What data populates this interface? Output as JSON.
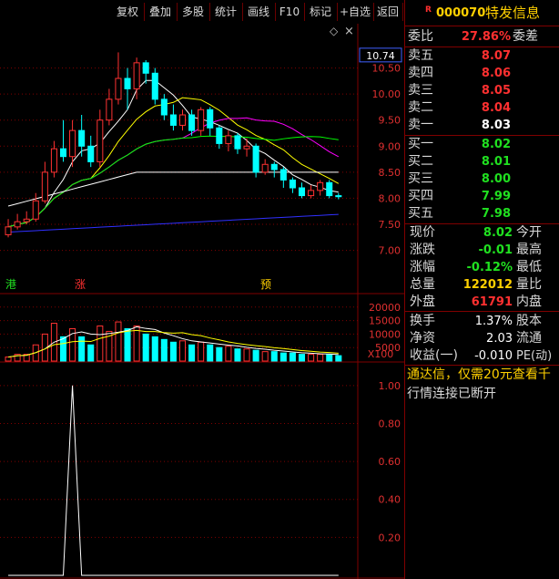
{
  "toolbar": {
    "buttons": [
      "复权",
      "叠加",
      "多股",
      "统计",
      "画线",
      "F10",
      "标记",
      "+自选",
      "返回"
    ]
  },
  "stock": {
    "r_mark": "R",
    "code": "000070",
    "name": "特发信息"
  },
  "orderbook": {
    "webi_label": "委比",
    "webi_value": "27.86%",
    "wecha_label": "委差",
    "asks": [
      {
        "label": "卖五",
        "price": "8.07"
      },
      {
        "label": "卖四",
        "price": "8.06"
      },
      {
        "label": "卖三",
        "price": "8.05"
      },
      {
        "label": "卖二",
        "price": "8.04"
      },
      {
        "label": "卖一",
        "price": "8.03"
      }
    ],
    "bids": [
      {
        "label": "买一",
        "price": "8.02"
      },
      {
        "label": "买二",
        "price": "8.01"
      },
      {
        "label": "买三",
        "price": "8.00"
      },
      {
        "label": "买四",
        "price": "7.99"
      },
      {
        "label": "买五",
        "price": "7.98"
      }
    ]
  },
  "quote": {
    "current_label": "现价",
    "current_value": "8.02",
    "open_label": "今开",
    "change_label": "涨跌",
    "change_value": "-0.01",
    "high_label": "最高",
    "pct_label": "涨幅",
    "pct_value": "-0.12%",
    "low_label": "最低",
    "volume_label": "总量",
    "volume_value": "122012",
    "ratio_label": "量比",
    "outer_label": "外盘",
    "outer_value": "61791",
    "inner_label": "内盘",
    "turnover_label": "换手",
    "turnover_value": "1.37%",
    "equity_label": "股本",
    "netasset_label": "净资",
    "netasset_value": "2.03",
    "float_label": "流通",
    "eps_label": "收益(一)",
    "eps_value": "-0.010",
    "pe_label": "PE(动)"
  },
  "notice": {
    "ad_text": "通达信，仅需20元查看千",
    "status_text": "行情连接已断开"
  },
  "price_axis": {
    "labels": [
      "10.50",
      "10.00",
      "9.50",
      "9.00",
      "8.50",
      "8.00",
      "7.50",
      "7.00"
    ],
    "current_price_box": "10.74"
  },
  "volume_axis": {
    "labels": [
      "20000",
      "15000",
      "10000",
      "5000"
    ],
    "unit": "X100"
  },
  "indicator_axis": {
    "labels": [
      "1.00",
      "0.80",
      "0.60",
      "0.40",
      "0.20"
    ]
  },
  "event_markers": [
    "港",
    "涨",
    "预"
  ],
  "colors": {
    "up": "#ff3232",
    "down": "#00ffff",
    "grid": "#800000",
    "ma5": "#ffffff",
    "ma10": "#ffff00",
    "ma20": "#ff00ff",
    "ma60": "#00ff00",
    "ma120": "#ffffff",
    "ma250": "#3030ff"
  },
  "chart_data": [
    {
      "type": "candlestick",
      "ylim": [
        6.8,
        11.0
      ],
      "ticks": [
        10.5,
        10.0,
        9.5,
        9.0,
        8.5,
        8.0,
        7.5,
        7.0
      ],
      "candles": [
        {
          "o": 7.3,
          "c": 7.45,
          "h": 7.6,
          "l": 7.25
        },
        {
          "o": 7.45,
          "c": 7.55,
          "h": 7.7,
          "l": 7.4
        },
        {
          "o": 7.55,
          "c": 7.6,
          "h": 7.75,
          "l": 7.5
        },
        {
          "o": 7.6,
          "c": 7.95,
          "h": 8.1,
          "l": 7.55
        },
        {
          "o": 7.95,
          "c": 8.5,
          "h": 8.7,
          "l": 7.9
        },
        {
          "o": 8.5,
          "c": 8.95,
          "h": 9.1,
          "l": 8.4
        },
        {
          "o": 8.95,
          "c": 8.8,
          "h": 9.5,
          "l": 8.7
        },
        {
          "o": 8.8,
          "c": 9.3,
          "h": 9.5,
          "l": 8.6
        },
        {
          "o": 9.3,
          "c": 9.0,
          "h": 9.6,
          "l": 8.8
        },
        {
          "o": 9.0,
          "c": 8.7,
          "h": 9.2,
          "l": 8.6
        },
        {
          "o": 8.7,
          "c": 9.5,
          "h": 9.7,
          "l": 8.6
        },
        {
          "o": 9.5,
          "c": 9.9,
          "h": 10.1,
          "l": 9.4
        },
        {
          "o": 9.9,
          "c": 10.3,
          "h": 10.8,
          "l": 9.8
        },
        {
          "o": 10.3,
          "c": 10.1,
          "h": 10.5,
          "l": 9.7
        },
        {
          "o": 10.1,
          "c": 10.6,
          "h": 10.7,
          "l": 9.9
        },
        {
          "o": 10.6,
          "c": 10.4,
          "h": 10.65,
          "l": 10.2
        },
        {
          "o": 10.4,
          "c": 9.9,
          "h": 10.5,
          "l": 9.8
        },
        {
          "o": 9.9,
          "c": 9.6,
          "h": 10.0,
          "l": 9.5
        },
        {
          "o": 9.6,
          "c": 9.4,
          "h": 9.8,
          "l": 9.3
        },
        {
          "o": 9.4,
          "c": 9.6,
          "h": 9.7,
          "l": 9.3
        },
        {
          "o": 9.6,
          "c": 9.3,
          "h": 9.7,
          "l": 9.2
        },
        {
          "o": 9.3,
          "c": 9.7,
          "h": 9.75,
          "l": 9.2
        },
        {
          "o": 9.7,
          "c": 9.35,
          "h": 9.75,
          "l": 9.2
        },
        {
          "o": 9.35,
          "c": 9.05,
          "h": 9.4,
          "l": 8.95
        },
        {
          "o": 9.05,
          "c": 9.2,
          "h": 9.3,
          "l": 8.9
        },
        {
          "o": 9.2,
          "c": 8.95,
          "h": 9.25,
          "l": 8.85
        },
        {
          "o": 8.95,
          "c": 9.0,
          "h": 9.15,
          "l": 8.8
        },
        {
          "o": 9.0,
          "c": 8.5,
          "h": 9.05,
          "l": 8.4
        },
        {
          "o": 8.5,
          "c": 8.65,
          "h": 8.75,
          "l": 8.45
        },
        {
          "o": 8.65,
          "c": 8.55,
          "h": 8.7,
          "l": 8.4
        },
        {
          "o": 8.55,
          "c": 8.35,
          "h": 8.6,
          "l": 8.2
        },
        {
          "o": 8.35,
          "c": 8.2,
          "h": 8.4,
          "l": 8.1
        },
        {
          "o": 8.2,
          "c": 8.05,
          "h": 8.3,
          "l": 8.0
        },
        {
          "o": 8.05,
          "c": 8.15,
          "h": 8.25,
          "l": 8.0
        },
        {
          "o": 8.15,
          "c": 8.3,
          "h": 8.35,
          "l": 8.05
        },
        {
          "o": 8.3,
          "c": 8.05,
          "h": 8.35,
          "l": 8.0
        },
        {
          "o": 8.05,
          "c": 8.03,
          "h": 8.1,
          "l": 7.98
        }
      ]
    },
    {
      "type": "bar",
      "title": "volume",
      "ylim": [
        0,
        25000
      ],
      "ticks": [
        20000,
        15000,
        10000,
        5000
      ],
      "values": [
        1500,
        2500,
        2500,
        6000,
        10000,
        14000,
        9000,
        12000,
        9000,
        6000,
        13000,
        11000,
        14500,
        12000,
        13000,
        10000,
        9000,
        8000,
        7000,
        7500,
        6000,
        7000,
        6000,
        5000,
        5500,
        4500,
        4500,
        4000,
        3500,
        3500,
        3000,
        3000,
        2500,
        2500,
        2500,
        2500,
        2000
      ],
      "up": [
        true,
        true,
        true,
        true,
        true,
        true,
        false,
        true,
        false,
        false,
        true,
        true,
        true,
        false,
        true,
        false,
        false,
        false,
        false,
        true,
        false,
        true,
        false,
        false,
        true,
        false,
        true,
        false,
        true,
        false,
        false,
        false,
        false,
        true,
        true,
        false,
        false
      ]
    },
    {
      "type": "line",
      "title": "indicator",
      "ylim": [
        0,
        1.1
      ],
      "ticks": [
        1.0,
        0.8,
        0.6,
        0.4,
        0.2
      ],
      "values": [
        0,
        0,
        0,
        0,
        0,
        0,
        0,
        1,
        0,
        0,
        0,
        0,
        0,
        0,
        0,
        0,
        0,
        0,
        0,
        0,
        0,
        0,
        0,
        0,
        0,
        0,
        0,
        0,
        0,
        0,
        0,
        0,
        0,
        0,
        0,
        0,
        0
      ]
    }
  ]
}
